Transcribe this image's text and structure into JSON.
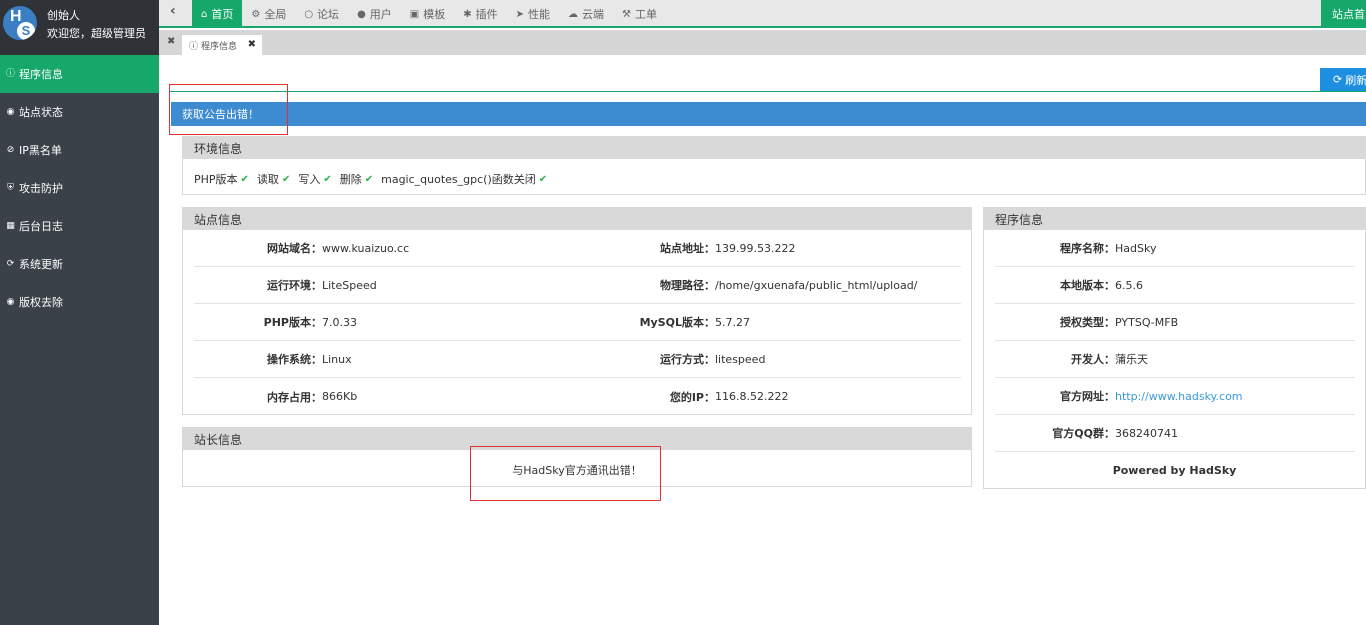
{
  "user": {
    "name": "创始人",
    "welcome": "欢迎您，超级管理员",
    "logo_letters": [
      "H",
      "S"
    ]
  },
  "sidebar": {
    "items": [
      {
        "label": "程序信息",
        "icon": "info-icon",
        "active": true
      },
      {
        "label": "站点状态",
        "icon": "status-icon",
        "active": false
      },
      {
        "label": "IP黑名单",
        "icon": "ban-icon",
        "active": false
      },
      {
        "label": "攻击防护",
        "icon": "shield-icon",
        "active": false
      },
      {
        "label": "后台日志",
        "icon": "calendar-icon",
        "active": false
      },
      {
        "label": "系统更新",
        "icon": "refresh-icon",
        "active": false
      },
      {
        "label": "版权去除",
        "icon": "circle-dot-icon",
        "active": false
      }
    ]
  },
  "topnav": {
    "items": [
      {
        "label": "首页",
        "icon": "home-icon",
        "active": true
      },
      {
        "label": "全局",
        "icon": "cogs-icon",
        "active": false
      },
      {
        "label": "论坛",
        "icon": "comments-icon",
        "active": false
      },
      {
        "label": "用户",
        "icon": "users-icon",
        "active": false
      },
      {
        "label": "模板",
        "icon": "puzzle-icon",
        "active": false
      },
      {
        "label": "插件",
        "icon": "plug-icon",
        "active": false
      },
      {
        "label": "性能",
        "icon": "rocket-icon",
        "active": false
      },
      {
        "label": "云端",
        "icon": "cloud-icon",
        "active": false
      },
      {
        "label": "工单",
        "icon": "wrench-icon",
        "active": false
      }
    ],
    "right_label": "站点首页"
  },
  "tabs": [
    {
      "label": "程序信息"
    }
  ],
  "refresh_label": "刷新",
  "notice": "获取公告出错！",
  "env": {
    "title": "环境信息",
    "checks": [
      "PHP版本",
      "读取",
      "写入",
      "删除",
      "magic_quotes_gpc()函数关闭"
    ]
  },
  "site": {
    "title": "站点信息",
    "rows": [
      {
        "l_label": "网站域名：",
        "l_value": "www.kuaizuo.cc",
        "r_label": "站点地址：",
        "r_value": "139.99.53.222"
      },
      {
        "l_label": "运行环境：",
        "l_value": "LiteSpeed",
        "r_label": "物理路径：",
        "r_value": "/home/gxuenafa/public_html/upload/"
      },
      {
        "l_label": "PHP版本：",
        "l_value": "7.0.33",
        "r_label": "MySQL版本：",
        "r_value": "5.7.27"
      },
      {
        "l_label": "操作系统：",
        "l_value": "Linux",
        "r_label": "运行方式：",
        "r_value": "litespeed"
      },
      {
        "l_label": "内存占用：",
        "l_value": "866Kb",
        "r_label": "您的IP：",
        "r_value": "116.8.52.222"
      }
    ]
  },
  "webmaster": {
    "title": "站长信息",
    "message": "与HadSky官方通讯出错！"
  },
  "program": {
    "title": "程序信息",
    "rows": [
      {
        "label": "程序名称：",
        "value": "HadSky"
      },
      {
        "label": "本地版本：",
        "value": "6.5.6"
      },
      {
        "label": "授权类型：",
        "value": "PYTSQ-MFB"
      },
      {
        "label": "开发人：",
        "value": "蒲乐天"
      },
      {
        "label": "官方网址：",
        "value": "http://www.hadsky.com"
      },
      {
        "label": "官方QQ群：",
        "value": "368240741"
      }
    ],
    "powered": "Powered by HadSky"
  },
  "colors": {
    "accent": "#15a86a",
    "sidebar": "#3b4148",
    "notice": "#3d8bd0",
    "refresh": "#1e8fe0",
    "link": "#3a9ad9",
    "ok": "#2db34a"
  }
}
